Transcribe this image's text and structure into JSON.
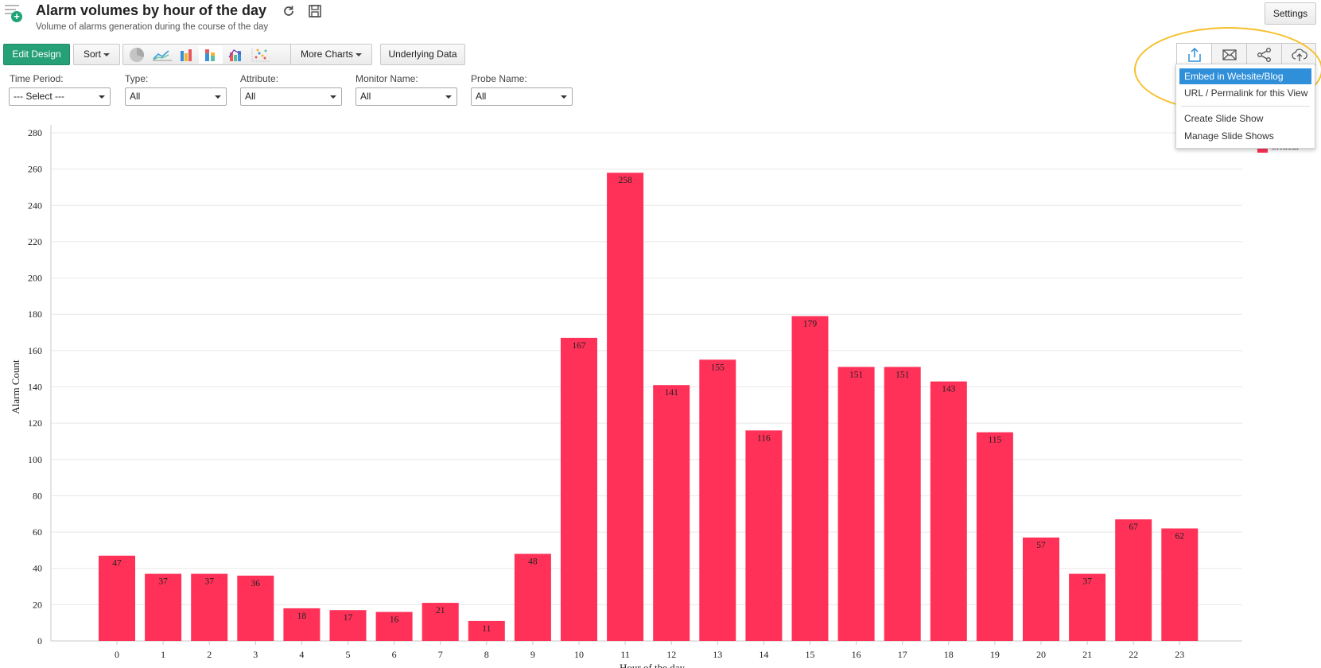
{
  "header": {
    "title": "Alarm volumes by hour of the day",
    "subtitle": "Volume of alarms generation during the course of the day",
    "settings_label": "Settings"
  },
  "toolbar": {
    "edit_design_label": "Edit Design",
    "sort_label": "Sort",
    "more_charts_label": "More Charts",
    "underlying_data_label": "Underlying Data",
    "chart_type_icons": [
      "pie-chart-icon",
      "line-chart-icon",
      "bar-chart-icon",
      "stacked-bar-chart-icon",
      "combination-chart-icon",
      "scatter-chart-icon"
    ],
    "active_chart_type": "stacked-bar-chart-icon"
  },
  "share_toolbar": {
    "icons": [
      "publish-icon",
      "email-icon",
      "share-icon",
      "export-icon"
    ],
    "menu_items": [
      "Embed in Website/Blog",
      "URL / Permalink for this View",
      "Create Slide Show",
      "Manage Slide Shows"
    ],
    "selected_item": "Embed in Website/Blog"
  },
  "filters": [
    {
      "label": "Time Period:",
      "value": "--- Select ---"
    },
    {
      "label": "Type:",
      "value": "All"
    },
    {
      "label": "Attribute:",
      "value": "All"
    },
    {
      "label": "Monitor Name:",
      "value": "All"
    },
    {
      "label": "Probe Name:",
      "value": "All"
    }
  ],
  "legend": {
    "label": "Critical",
    "color": "#ff3158"
  },
  "chart_data": {
    "type": "bar",
    "categories": [
      "0",
      "1",
      "2",
      "3",
      "4",
      "5",
      "6",
      "7",
      "8",
      "9",
      "10",
      "11",
      "12",
      "13",
      "14",
      "15",
      "16",
      "17",
      "18",
      "19",
      "20",
      "21",
      "22",
      "23"
    ],
    "series": [
      {
        "name": "Critical",
        "values": [
          47,
          37,
          37,
          36,
          18,
          17,
          16,
          21,
          11,
          48,
          167,
          258,
          141,
          155,
          116,
          179,
          151,
          151,
          143,
          115,
          57,
          37,
          67,
          62
        ]
      }
    ],
    "xlabel": "Hour of the day",
    "ylabel": "Alarm Count",
    "ylim": [
      0,
      280
    ],
    "yticks": [
      0,
      20,
      40,
      60,
      80,
      100,
      120,
      140,
      160,
      180,
      200,
      220,
      240,
      260,
      280
    ],
    "grid": true,
    "bar_color": "#ff3158"
  }
}
